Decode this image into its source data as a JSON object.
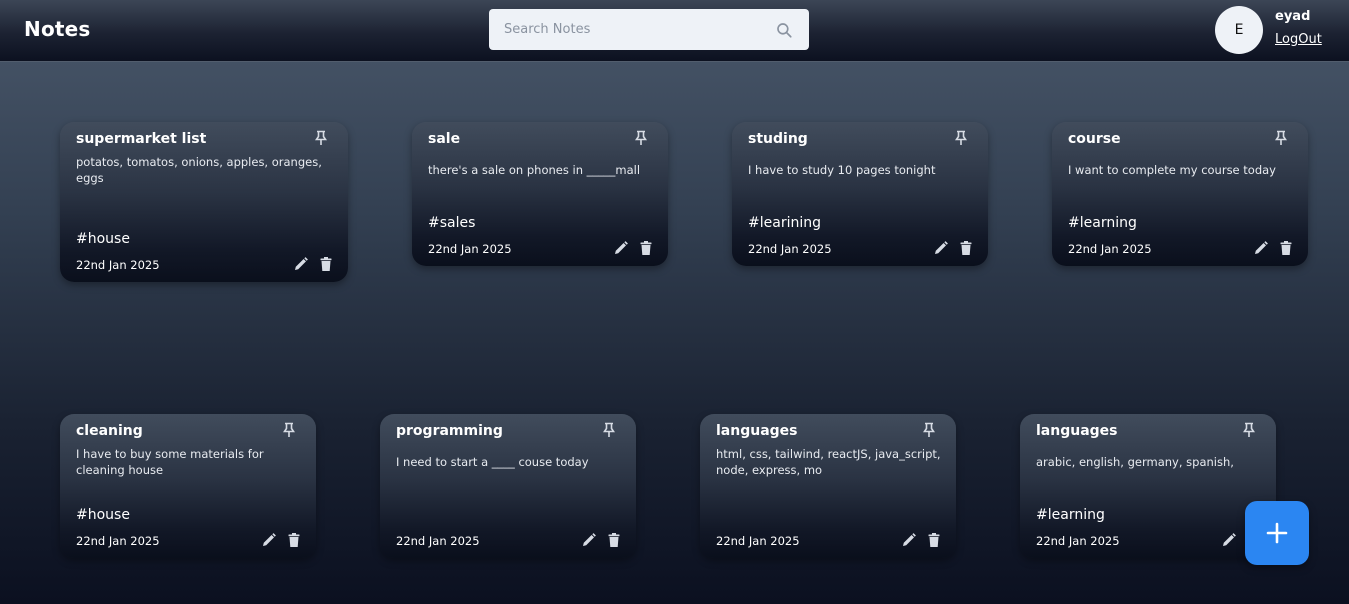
{
  "app": {
    "title": "Notes"
  },
  "search": {
    "placeholder": "Search Notes"
  },
  "user": {
    "initial": "E",
    "name": "eyad",
    "logout_label": "LogOut"
  },
  "colors": {
    "accent": "#2b86f2",
    "icon": "#d7dce4"
  },
  "notes": [
    {
      "title": "supermarket list",
      "content": "potatos, tomatos, onions, apples, oranges,\neggs",
      "tag": "#house",
      "date": "22nd Jan 2025"
    },
    {
      "title": "sale",
      "content": "there's a sale on phones in _____mall",
      "tag": "#sales",
      "date": "22nd Jan 2025"
    },
    {
      "title": "studing",
      "content": "I have to study 10 pages tonight",
      "tag": "#learining",
      "date": "22nd Jan 2025"
    },
    {
      "title": "course",
      "content": "I want to complete my course today",
      "tag": "#learning",
      "date": "22nd Jan 2025"
    },
    {
      "title": "cleaning",
      "content": "I have to buy some materials for\ncleaning house",
      "tag": "#house",
      "date": "22nd Jan 2025"
    },
    {
      "title": "programming",
      "content": "I need to start a ____ couse today",
      "tag": "",
      "date": "22nd Jan 2025"
    },
    {
      "title": "languages",
      "content": "html, css, tailwind, reactJS, java_script,\nnode, express, mo",
      "tag": "",
      "date": "22nd Jan 2025"
    },
    {
      "title": "languages",
      "content": "arabic, english, germany, spanish,",
      "tag": "#learning",
      "date": "22nd Jan 2025"
    }
  ],
  "icons": {
    "pin": "pin-icon",
    "edit": "edit-icon",
    "delete": "trash-icon",
    "search": "search-icon",
    "add": "plus-icon"
  }
}
